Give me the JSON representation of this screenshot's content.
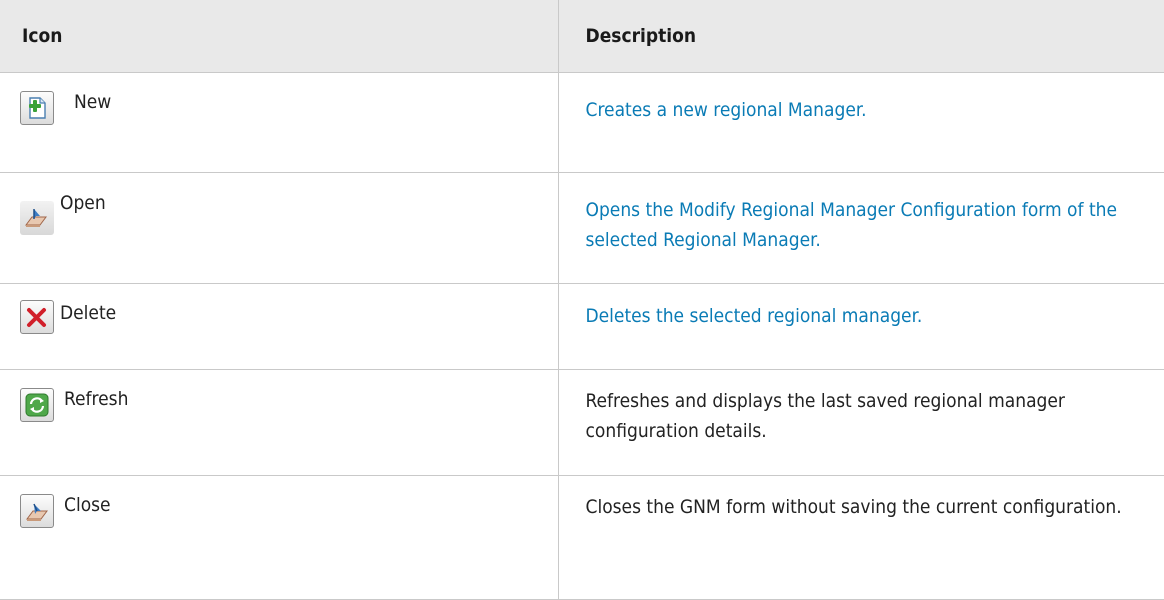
{
  "headers": {
    "icon": "Icon",
    "description": "Description"
  },
  "rows": [
    {
      "icon": "new-icon",
      "label": "New",
      "description": "Creates a new regional Manager.",
      "description_color": "#0a7bb5"
    },
    {
      "icon": "open-icon",
      "label": "Open",
      "description": "Opens the Modify Regional Manager Configuration form of the selected Regional Manager.",
      "description_color": "#0a7bb5"
    },
    {
      "icon": "delete-icon",
      "label": "Delete",
      "description": "Deletes the selected regional manager.",
      "description_color": "#0a7bb5"
    },
    {
      "icon": "refresh-icon",
      "label": "Refresh",
      "description": "Refreshes and displays the last saved regional manager configuration details.",
      "description_color": "#222222"
    },
    {
      "icon": "close-icon",
      "label": "Close",
      "description": "Closes the GNM form without saving the current configuration.",
      "description_color": "#222222"
    }
  ]
}
